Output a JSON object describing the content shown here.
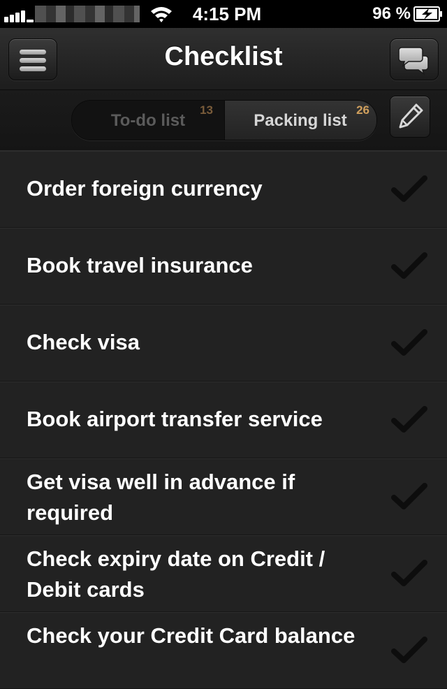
{
  "status_bar": {
    "time": "4:15 PM",
    "battery_percent": "96 %",
    "icons": [
      "signal-icon",
      "wifi-icon",
      "battery-charging-icon"
    ]
  },
  "nav": {
    "title": "Checklist",
    "left_icon": "menu-icon",
    "right_icon": "chat-bubbles-icon"
  },
  "segments": {
    "todo": {
      "label": "To-do list",
      "count": "13"
    },
    "packing": {
      "label": "Packing list",
      "count": "26"
    },
    "selected": "packing",
    "edit_icon": "pencil-icon"
  },
  "items": [
    {
      "text": "Order foreign currency"
    },
    {
      "text": "Book travel insurance"
    },
    {
      "text": "Check visa"
    },
    {
      "text": "Book airport transfer service"
    },
    {
      "text": "Get visa well in advance if required"
    },
    {
      "text": "Check expiry date on Credit / Debit cards"
    },
    {
      "text": "Check your Credit Card balance"
    }
  ],
  "colors": {
    "background": "#222222",
    "badge_accent": "#d1a05d",
    "text": "#ffffff",
    "check": "#0d0d0d"
  }
}
